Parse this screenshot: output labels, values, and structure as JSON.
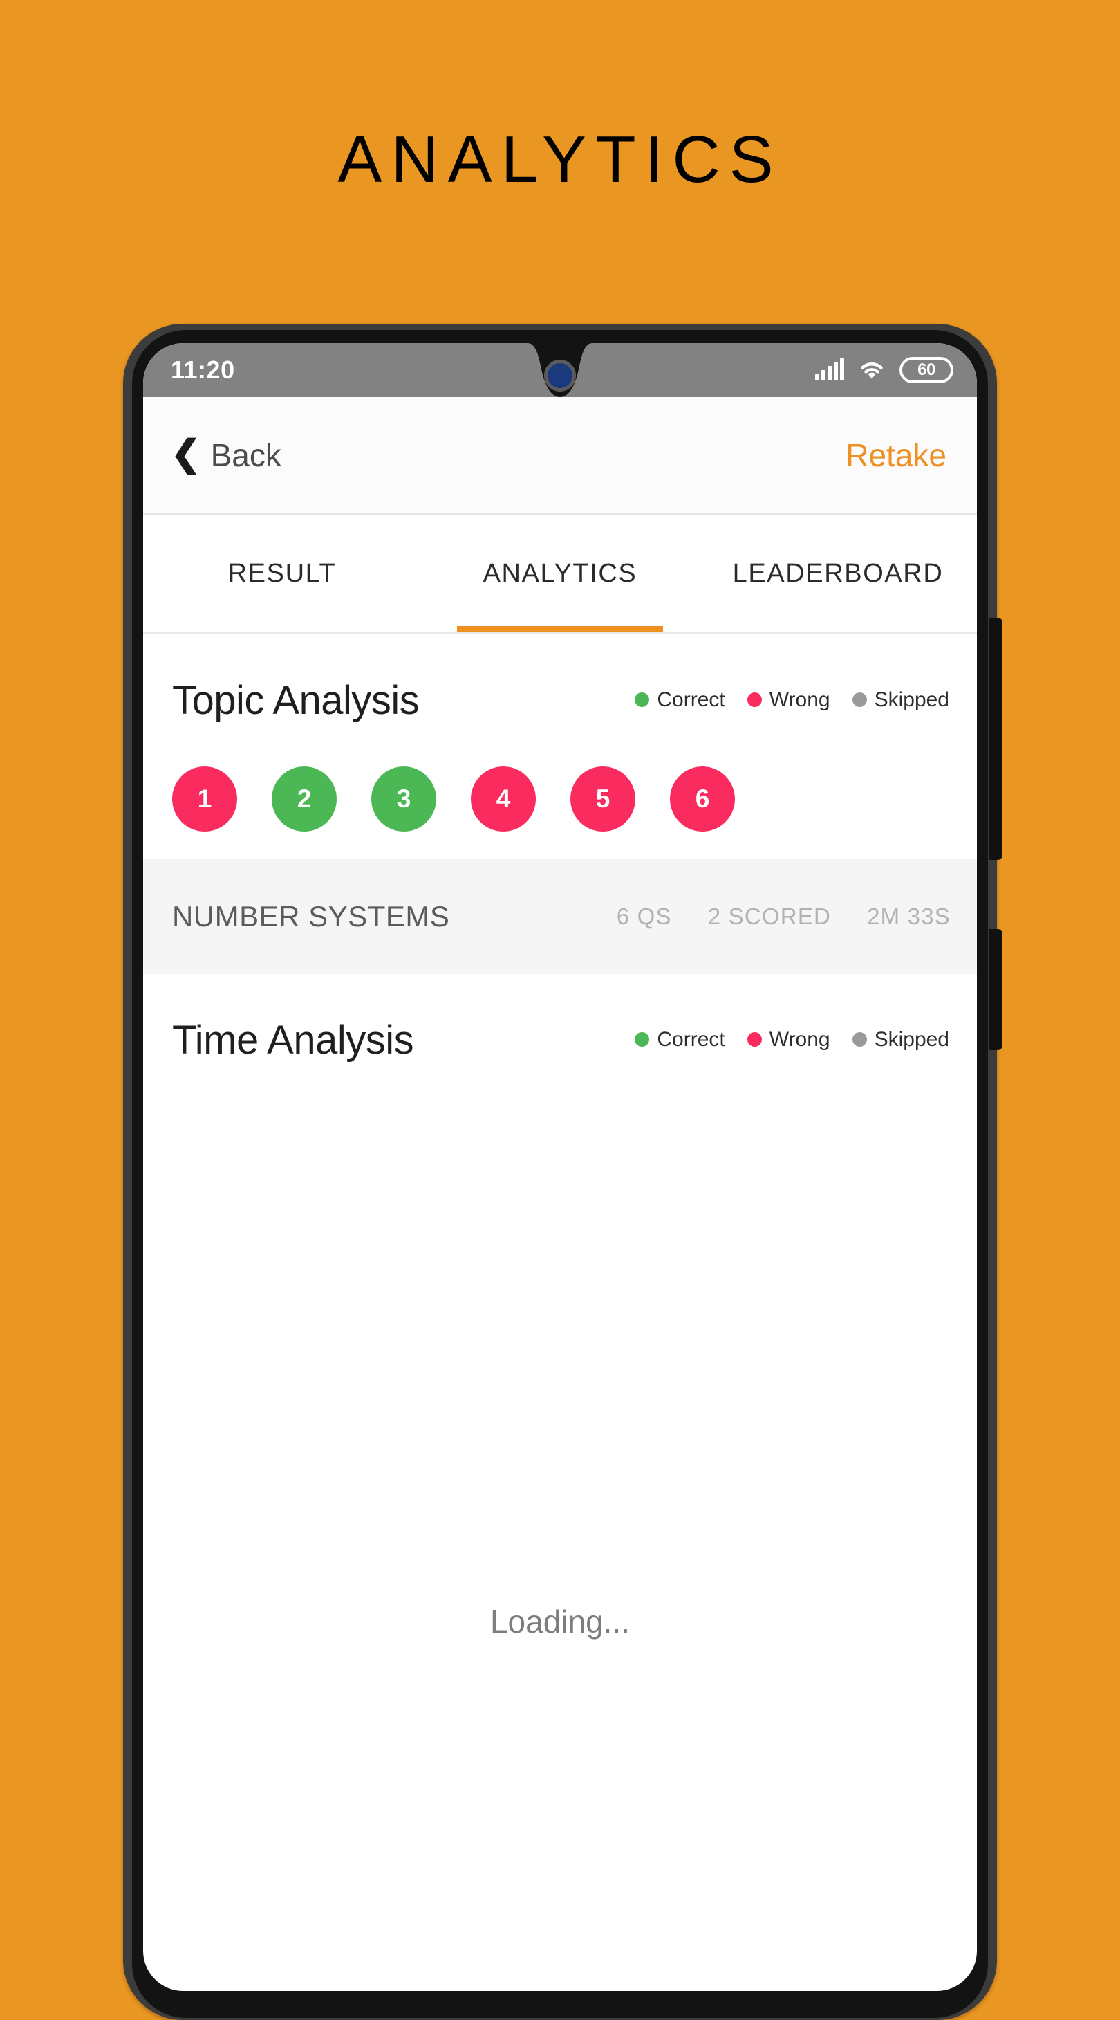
{
  "page": {
    "title": "ANALYTICS",
    "background_color": "#EA9622"
  },
  "phone": {
    "status_bar": {
      "time": "11:20",
      "battery_level": "60",
      "signal_icon": "signal-bars-icon",
      "wifi_icon": "wifi-icon",
      "battery_icon": "battery-icon"
    },
    "app_bar": {
      "back_label": "Back",
      "back_icon": "chevron-left-icon",
      "retake_label": "Retake",
      "retake_color": "#EF9022"
    },
    "tabs": [
      {
        "label": "RESULT",
        "active": false
      },
      {
        "label": "ANALYTICS",
        "active": true
      },
      {
        "label": "LEADERBOARD",
        "active": false
      }
    ],
    "topic_analysis": {
      "title": "Topic Analysis",
      "legend": [
        {
          "label": "Correct",
          "color": "#4CB755"
        },
        {
          "label": "Wrong",
          "color": "#FA2B5E"
        },
        {
          "label": "Skipped",
          "color": "#9A9A9A"
        }
      ],
      "questions": [
        {
          "number": "1",
          "status": "wrong",
          "color": "#FA2B5E"
        },
        {
          "number": "2",
          "status": "correct",
          "color": "#4CB755"
        },
        {
          "number": "3",
          "status": "correct",
          "color": "#4CB755"
        },
        {
          "number": "4",
          "status": "wrong",
          "color": "#FA2B5E"
        },
        {
          "number": "5",
          "status": "wrong",
          "color": "#FA2B5E"
        },
        {
          "number": "6",
          "status": "wrong",
          "color": "#FA2B5E"
        }
      ],
      "summary": {
        "topic": "NUMBER SYSTEMS",
        "questions_count": "6 QS",
        "scored": "2 SCORED",
        "time": "2M 33S"
      }
    },
    "time_analysis": {
      "title": "Time Analysis",
      "legend": [
        {
          "label": "Correct",
          "color": "#4CB755"
        },
        {
          "label": "Wrong",
          "color": "#FA2B5E"
        },
        {
          "label": "Skipped",
          "color": "#9A9A9A"
        }
      ],
      "loading_text": "Loading..."
    }
  }
}
